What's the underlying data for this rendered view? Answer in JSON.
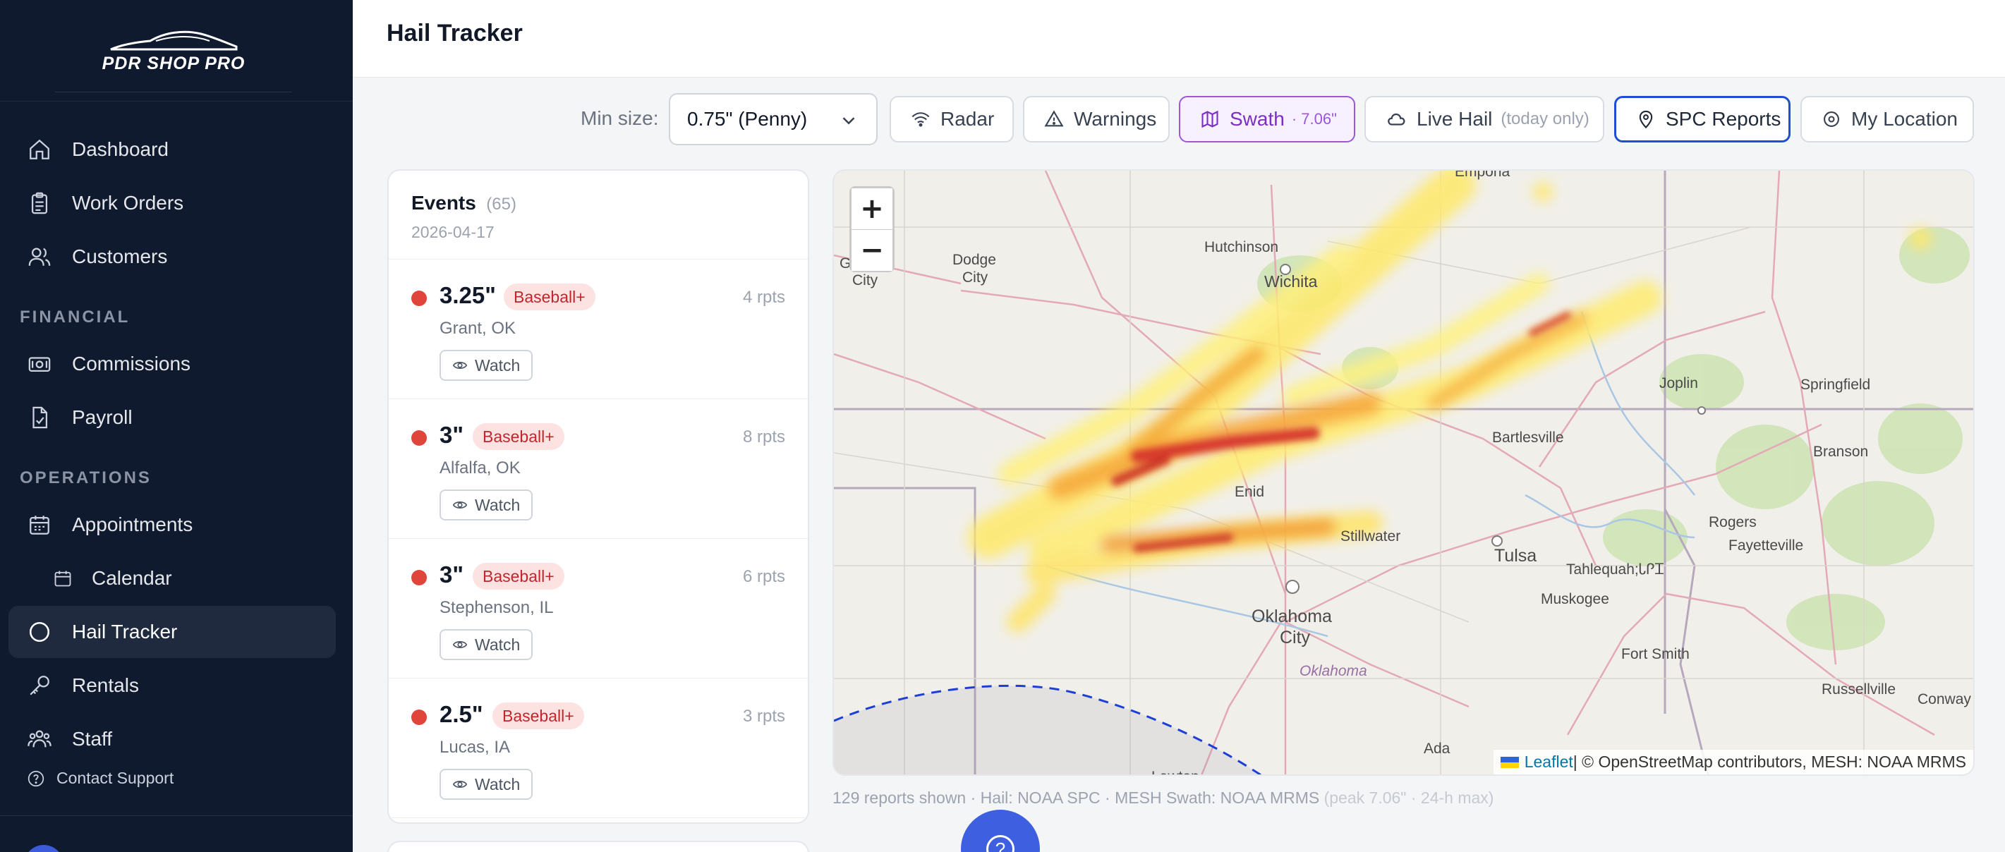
{
  "brand": {
    "name": "PDR SHOP PRO"
  },
  "sidebar": {
    "items": [
      {
        "label": "Dashboard",
        "icon": "home-icon"
      },
      {
        "label": "Work Orders",
        "icon": "clipboard-icon"
      },
      {
        "label": "Customers",
        "icon": "users-icon"
      }
    ],
    "financial_label": "FINANCIAL",
    "financial": [
      {
        "label": "Commissions",
        "icon": "banknote-icon"
      },
      {
        "label": "Payroll",
        "icon": "file-check-icon"
      }
    ],
    "operations_label": "OPERATIONS",
    "operations": [
      {
        "label": "Appointments",
        "icon": "calendar-days-icon"
      },
      {
        "label": "Calendar",
        "icon": "calendar-icon"
      },
      {
        "label": "Hail Tracker",
        "icon": "circle-icon",
        "active": true
      },
      {
        "label": "Rentals",
        "icon": "key-icon"
      },
      {
        "label": "Staff",
        "icon": "team-icon"
      }
    ],
    "support_label": "Contact Support"
  },
  "header": {
    "title": "Hail Tracker"
  },
  "toolbar": {
    "min_size_label": "Min size:",
    "min_size_value": "0.75\" (Penny)",
    "radar": "Radar",
    "warnings": "Warnings",
    "swath": "Swath",
    "swath_extra": "· 7.06\"",
    "live_hail": "Live Hail",
    "live_hail_note": "(today only)",
    "spc_reports": "SPC Reports",
    "my_location": "My Location"
  },
  "events": {
    "title": "Events",
    "count": "(65)",
    "date": "2026-04-17",
    "watch_label": "Watch",
    "items": [
      {
        "size": "3.25\"",
        "badge": "Baseball+",
        "location": "Grant, OK",
        "reports": "4 rpts"
      },
      {
        "size": "3\"",
        "badge": "Baseball+",
        "location": "Alfalfa, OK",
        "reports": "8 rpts"
      },
      {
        "size": "3\"",
        "badge": "Baseball+",
        "location": "Stephenson, IL",
        "reports": "6 rpts"
      },
      {
        "size": "2.5\"",
        "badge": "Baseball+",
        "location": "Lucas, IA",
        "reports": "3 rpts"
      }
    ]
  },
  "map": {
    "zoom_in": "+",
    "zoom_out": "−",
    "labels": {
      "hutchinson": "Hutchinson",
      "dodge_city": "Dodge\nCity",
      "garden_city": "City",
      "wichita": "Wichita",
      "emporia": "Emporia",
      "springfield": "Springfield",
      "joplin": "Joplin",
      "bartlesville": "Bartlesville",
      "branson": "Branson",
      "rogers": "Rogers",
      "fayetteville": "Fayetteville",
      "enid": "Enid",
      "stillwater": "Stillwater",
      "tulsa": "Tulsa",
      "tahlequah": "Tahlequah;ᏓᎵᏆ",
      "muskogee": "Muskogee",
      "oklahoma_city": "Oklahoma\nCity",
      "oklahoma": "Oklahoma",
      "fort_smith": "Fort Smith",
      "russellville": "Russellville",
      "conway": "Conway",
      "ada": "Ada",
      "lawton": "Lawton"
    },
    "attribution_link": "Leaflet",
    "attribution_text": " | © OpenStreetMap contributors, MESH: NOAA MRMS"
  },
  "footnote": {
    "main": "129 reports shown · Hail: NOAA SPC · MESH Swath: NOAA MRMS",
    "faint": "(peak 7.06\" · 24-h max)"
  },
  "colors": {
    "sidebar_bg": "#0f1a2e",
    "accent_blue": "#1d4ed8",
    "swath_purple": "#9a57d6",
    "badge_red": "#c0262c",
    "dot_red": "#e0453b"
  }
}
